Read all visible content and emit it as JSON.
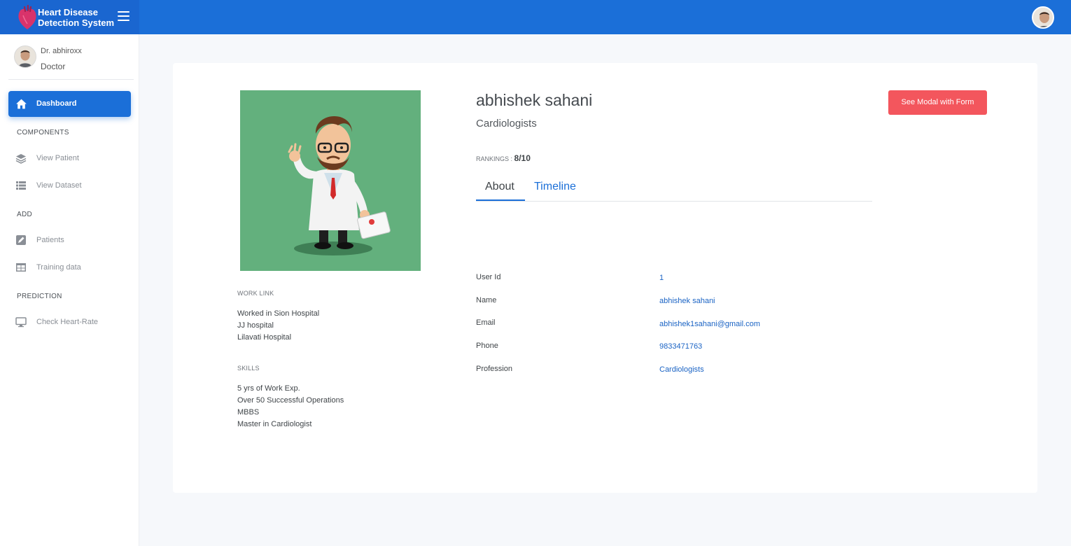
{
  "brand": {
    "line1": "Heart Disease",
    "line2": "Detection System"
  },
  "colors": {
    "primary": "#1b6fd8",
    "danger": "#f3565d",
    "link": "#1a63c4",
    "image_bg": "#63b07d"
  },
  "sidebar": {
    "user_name": "Dr. abhiroxx",
    "user_role": "Doctor",
    "active_item": {
      "label": "Dashboard",
      "icon": "home-icon"
    },
    "sections": {
      "components": "COMPONENTS",
      "add": "ADD",
      "prediction": "PREDICTION"
    },
    "items": [
      {
        "label": "View Patient",
        "icon": "layers-icon"
      },
      {
        "label": "View Dataset",
        "icon": "list-icon"
      },
      {
        "label": "Patients",
        "icon": "edit-icon"
      },
      {
        "label": "Training data",
        "icon": "table-icon"
      },
      {
        "label": "Check Heart-Rate",
        "icon": "monitor-icon"
      }
    ]
  },
  "profile": {
    "name": "abhishek sahani",
    "profession": "Cardiologists",
    "rank_label": "RANKINGS :",
    "rank_value": "8/10",
    "modal_button": "See Modal with Form",
    "tabs": [
      "About",
      "Timeline"
    ],
    "work_link_heading": "WORK LINK",
    "work_links": [
      "Worked in Sion Hospital",
      "JJ hospital",
      "Lilavati Hospital"
    ],
    "skills_heading": "SKILLS",
    "skills": [
      "5 yrs of Work Exp.",
      "Over 50 Successful Operations",
      "MBBS",
      "Master in Cardiologist"
    ],
    "details": [
      {
        "label": "User Id",
        "value": "1"
      },
      {
        "label": "Name",
        "value": "abhishek sahani"
      },
      {
        "label": "Email",
        "value": "abhishek1sahani@gmail.com"
      },
      {
        "label": "Phone",
        "value": "9833471763"
      },
      {
        "label": "Profession",
        "value": "Cardiologists"
      }
    ]
  }
}
